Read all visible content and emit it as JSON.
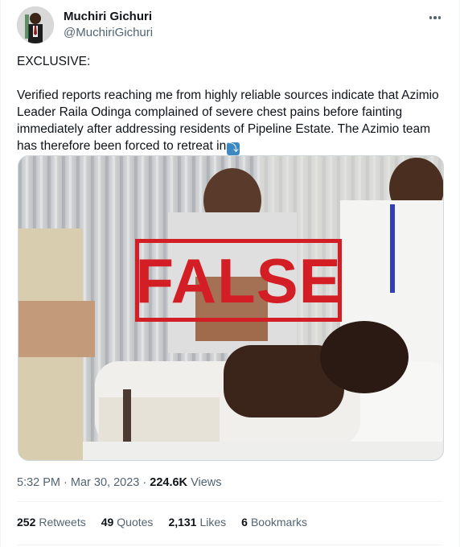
{
  "author": {
    "display_name": "Muchiri Gichuri",
    "handle": "@MuchiriGichuri",
    "avatar": "avatar"
  },
  "header": {
    "more_icon": "more-horizontal-icon"
  },
  "tweet": {
    "text": "EXCLUSIVE:\n\nVerified reports reaching me from highly reliable sources indicate that Azimio Leader Raila Odinga complained of severe chest pains before fainting immediately after addressing residents of Pipeline Estate. The Azimio team has therefore been forced to retreat in",
    "emoji": "⤵",
    "emoji_icon": "arrow-curving-down-icon"
  },
  "media": {
    "stamp_text": "FALSE",
    "stamp_color": "#d31e25"
  },
  "meta": {
    "time": "5:32 PM",
    "separator": "·",
    "date": "Mar 30, 2023",
    "views_count": "224.6K",
    "views_label": "Views"
  },
  "stats": [
    {
      "count": "252",
      "label": "Retweets"
    },
    {
      "count": "49",
      "label": "Quotes"
    },
    {
      "count": "2,131",
      "label": "Likes"
    },
    {
      "count": "6",
      "label": "Bookmarks"
    }
  ],
  "colors": {
    "text_primary": "#0f1419",
    "text_secondary": "#536471",
    "border": "#eff3f4"
  }
}
